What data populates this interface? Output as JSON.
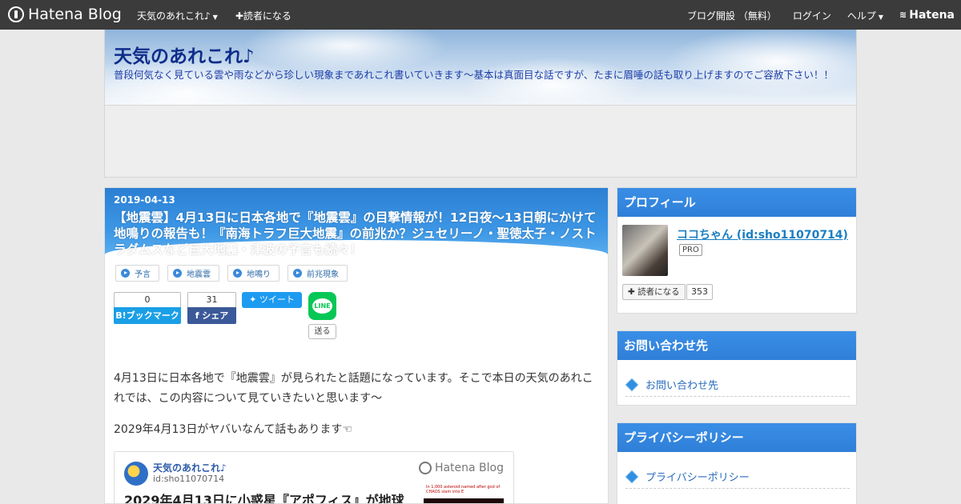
{
  "topbar": {
    "logo": "Hatena Blog",
    "blog_menu": "天気のあれこれ♪",
    "subscribe": "✚読者になる",
    "open_blog": "ブログ開設 （無料）",
    "login": "ログイン",
    "help": "ヘルプ",
    "hatena": "Hatena"
  },
  "header": {
    "title": "天気のあれこれ♪",
    "description": "普段何気なく見ている雲や雨などから珍しい現象まであれこれ書いていきます～基本は真面目な話ですが、たまに眉唾の話も取り上げますのでご容赦下さい！！"
  },
  "article": {
    "date": "2019-04-13",
    "title": "【地震雲】4月13日に日本各地で『地震雲』の目撃情報が！12日夜～13日朝にかけて地鳴りの報告も！『南海トラフ巨大地震』の前兆か？ジュセリーノ・聖徳太子・ノストラダムスなど巨大地震・津波の予言も続々！",
    "tags": [
      "予言",
      "地震雲",
      "地鳴り",
      "前兆現象"
    ],
    "share": {
      "hatena_count": "0",
      "hatena_label": "B!ブックマーク",
      "facebook_count": "31",
      "facebook_label": "f シェア",
      "tweet_label": "ツイート",
      "line_label": "LINE",
      "send_label": "送る"
    },
    "paragraphs": [
      "4月13日に日本各地で『地震雲』が見られたと話題になっています。そこで本日の天気のあれこれでは、この内容について見ていきたいと思います～",
      "2029年4月13日がヤバいなんて話もあります☜"
    ],
    "embed": {
      "blog": "天気のあれこれ♪",
      "id": "id:sho11070714",
      "service": "Hatena Blog",
      "title": "2029年4月13日に小惑星『アポフィス』が地球",
      "thumb_text": "In 1,000 asteroid named after god of CHAOS slam into E"
    }
  },
  "sidebar": {
    "profile": {
      "heading": "プロフィール",
      "name": "ココちゃん (id:sho11070714)",
      "badge": "PRO",
      "reader_button": "✚ 読者になる",
      "reader_count": "353"
    },
    "contact": {
      "heading": "お問い合わせ先",
      "link": "お問い合わせ先"
    },
    "privacy": {
      "heading": "プライバシーポリシー",
      "link": "プライバシーポリシー"
    }
  }
}
